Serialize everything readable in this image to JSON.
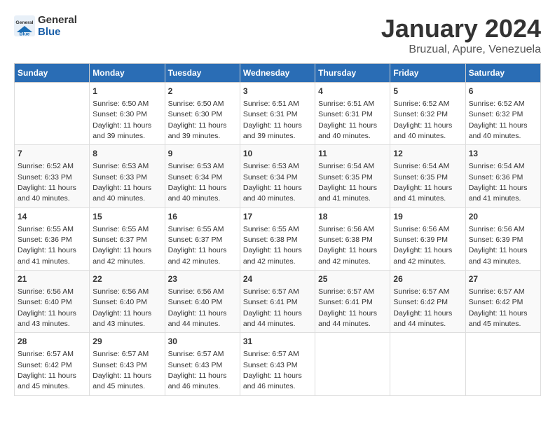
{
  "header": {
    "logo_general": "General",
    "logo_blue": "Blue",
    "title": "January 2024",
    "subtitle": "Bruzual, Apure, Venezuela"
  },
  "columns": [
    "Sunday",
    "Monday",
    "Tuesday",
    "Wednesday",
    "Thursday",
    "Friday",
    "Saturday"
  ],
  "weeks": [
    [
      {
        "date": "",
        "sunrise": "",
        "sunset": "",
        "daylight": ""
      },
      {
        "date": "1",
        "sunrise": "Sunrise: 6:50 AM",
        "sunset": "Sunset: 6:30 PM",
        "daylight": "Daylight: 11 hours and 39 minutes."
      },
      {
        "date": "2",
        "sunrise": "Sunrise: 6:50 AM",
        "sunset": "Sunset: 6:30 PM",
        "daylight": "Daylight: 11 hours and 39 minutes."
      },
      {
        "date": "3",
        "sunrise": "Sunrise: 6:51 AM",
        "sunset": "Sunset: 6:31 PM",
        "daylight": "Daylight: 11 hours and 39 minutes."
      },
      {
        "date": "4",
        "sunrise": "Sunrise: 6:51 AM",
        "sunset": "Sunset: 6:31 PM",
        "daylight": "Daylight: 11 hours and 40 minutes."
      },
      {
        "date": "5",
        "sunrise": "Sunrise: 6:52 AM",
        "sunset": "Sunset: 6:32 PM",
        "daylight": "Daylight: 11 hours and 40 minutes."
      },
      {
        "date": "6",
        "sunrise": "Sunrise: 6:52 AM",
        "sunset": "Sunset: 6:32 PM",
        "daylight": "Daylight: 11 hours and 40 minutes."
      }
    ],
    [
      {
        "date": "7",
        "sunrise": "Sunrise: 6:52 AM",
        "sunset": "Sunset: 6:33 PM",
        "daylight": "Daylight: 11 hours and 40 minutes."
      },
      {
        "date": "8",
        "sunrise": "Sunrise: 6:53 AM",
        "sunset": "Sunset: 6:33 PM",
        "daylight": "Daylight: 11 hours and 40 minutes."
      },
      {
        "date": "9",
        "sunrise": "Sunrise: 6:53 AM",
        "sunset": "Sunset: 6:34 PM",
        "daylight": "Daylight: 11 hours and 40 minutes."
      },
      {
        "date": "10",
        "sunrise": "Sunrise: 6:53 AM",
        "sunset": "Sunset: 6:34 PM",
        "daylight": "Daylight: 11 hours and 40 minutes."
      },
      {
        "date": "11",
        "sunrise": "Sunrise: 6:54 AM",
        "sunset": "Sunset: 6:35 PM",
        "daylight": "Daylight: 11 hours and 41 minutes."
      },
      {
        "date": "12",
        "sunrise": "Sunrise: 6:54 AM",
        "sunset": "Sunset: 6:35 PM",
        "daylight": "Daylight: 11 hours and 41 minutes."
      },
      {
        "date": "13",
        "sunrise": "Sunrise: 6:54 AM",
        "sunset": "Sunset: 6:36 PM",
        "daylight": "Daylight: 11 hours and 41 minutes."
      }
    ],
    [
      {
        "date": "14",
        "sunrise": "Sunrise: 6:55 AM",
        "sunset": "Sunset: 6:36 PM",
        "daylight": "Daylight: 11 hours and 41 minutes."
      },
      {
        "date": "15",
        "sunrise": "Sunrise: 6:55 AM",
        "sunset": "Sunset: 6:37 PM",
        "daylight": "Daylight: 11 hours and 42 minutes."
      },
      {
        "date": "16",
        "sunrise": "Sunrise: 6:55 AM",
        "sunset": "Sunset: 6:37 PM",
        "daylight": "Daylight: 11 hours and 42 minutes."
      },
      {
        "date": "17",
        "sunrise": "Sunrise: 6:55 AM",
        "sunset": "Sunset: 6:38 PM",
        "daylight": "Daylight: 11 hours and 42 minutes."
      },
      {
        "date": "18",
        "sunrise": "Sunrise: 6:56 AM",
        "sunset": "Sunset: 6:38 PM",
        "daylight": "Daylight: 11 hours and 42 minutes."
      },
      {
        "date": "19",
        "sunrise": "Sunrise: 6:56 AM",
        "sunset": "Sunset: 6:39 PM",
        "daylight": "Daylight: 11 hours and 42 minutes."
      },
      {
        "date": "20",
        "sunrise": "Sunrise: 6:56 AM",
        "sunset": "Sunset: 6:39 PM",
        "daylight": "Daylight: 11 hours and 43 minutes."
      }
    ],
    [
      {
        "date": "21",
        "sunrise": "Sunrise: 6:56 AM",
        "sunset": "Sunset: 6:40 PM",
        "daylight": "Daylight: 11 hours and 43 minutes."
      },
      {
        "date": "22",
        "sunrise": "Sunrise: 6:56 AM",
        "sunset": "Sunset: 6:40 PM",
        "daylight": "Daylight: 11 hours and 43 minutes."
      },
      {
        "date": "23",
        "sunrise": "Sunrise: 6:56 AM",
        "sunset": "Sunset: 6:40 PM",
        "daylight": "Daylight: 11 hours and 44 minutes."
      },
      {
        "date": "24",
        "sunrise": "Sunrise: 6:57 AM",
        "sunset": "Sunset: 6:41 PM",
        "daylight": "Daylight: 11 hours and 44 minutes."
      },
      {
        "date": "25",
        "sunrise": "Sunrise: 6:57 AM",
        "sunset": "Sunset: 6:41 PM",
        "daylight": "Daylight: 11 hours and 44 minutes."
      },
      {
        "date": "26",
        "sunrise": "Sunrise: 6:57 AM",
        "sunset": "Sunset: 6:42 PM",
        "daylight": "Daylight: 11 hours and 44 minutes."
      },
      {
        "date": "27",
        "sunrise": "Sunrise: 6:57 AM",
        "sunset": "Sunset: 6:42 PM",
        "daylight": "Daylight: 11 hours and 45 minutes."
      }
    ],
    [
      {
        "date": "28",
        "sunrise": "Sunrise: 6:57 AM",
        "sunset": "Sunset: 6:42 PM",
        "daylight": "Daylight: 11 hours and 45 minutes."
      },
      {
        "date": "29",
        "sunrise": "Sunrise: 6:57 AM",
        "sunset": "Sunset: 6:43 PM",
        "daylight": "Daylight: 11 hours and 45 minutes."
      },
      {
        "date": "30",
        "sunrise": "Sunrise: 6:57 AM",
        "sunset": "Sunset: 6:43 PM",
        "daylight": "Daylight: 11 hours and 46 minutes."
      },
      {
        "date": "31",
        "sunrise": "Sunrise: 6:57 AM",
        "sunset": "Sunset: 6:43 PM",
        "daylight": "Daylight: 11 hours and 46 minutes."
      },
      {
        "date": "",
        "sunrise": "",
        "sunset": "",
        "daylight": ""
      },
      {
        "date": "",
        "sunrise": "",
        "sunset": "",
        "daylight": ""
      },
      {
        "date": "",
        "sunrise": "",
        "sunset": "",
        "daylight": ""
      }
    ]
  ]
}
